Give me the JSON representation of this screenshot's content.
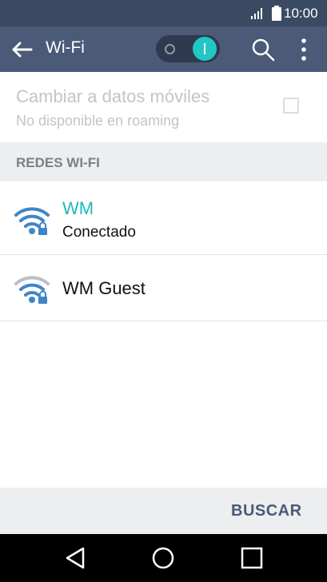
{
  "status_bar": {
    "time": "10:00"
  },
  "app_bar": {
    "title": "Wi-Fi",
    "wifi_toggle_on": true
  },
  "mobile_data": {
    "title": "Cambiar a datos móviles",
    "subtitle": "No disponible en roaming",
    "checked": false
  },
  "section": {
    "label": "REDES WI-FI"
  },
  "networks": [
    {
      "name": "WM",
      "status": "Conectado",
      "secured": true,
      "connected": true
    },
    {
      "name": "WM Guest",
      "secured": true,
      "connected": false
    }
  ],
  "bottom_bar": {
    "scan_label": "BUSCAR"
  },
  "colors": {
    "status_bar": "#3b4a63",
    "app_bar": "#4a5a77",
    "accent": "#22c6c4",
    "connected_text": "#22b8b6",
    "wifi_icon": "#3e86c8",
    "section_bg": "#eceeef"
  },
  "icons": {
    "back": "arrow-left-icon",
    "search": "search-icon",
    "more": "more-vertical-icon",
    "wifi_secured": "wifi-lock-icon",
    "nav_back": "triangle-back-icon",
    "nav_home": "circle-home-icon",
    "nav_recents": "square-recents-icon"
  }
}
